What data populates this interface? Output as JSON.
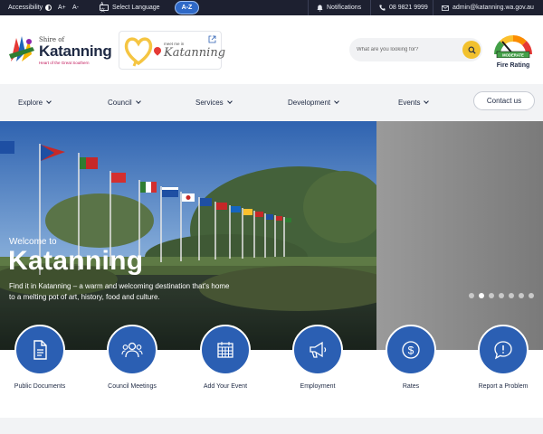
{
  "topbar": {
    "accessibility": "Accessibility",
    "font_up": "A+",
    "font_down": "A-",
    "language": "Select Language",
    "az": "A-Z",
    "notifications": "Notifications",
    "phone": "08 9821 9999",
    "email": "admin@katanning.wa.gov.au"
  },
  "logo": {
    "shire": "Shire of",
    "name": "Katanning",
    "tagline": "Heart of the Great Southern"
  },
  "meet": {
    "small": "meet me in",
    "name": "Katanning"
  },
  "search": {
    "placeholder": "What are you looking for?"
  },
  "fire": {
    "level": "MODERATE",
    "label": "Fire Rating"
  },
  "nav": {
    "items": [
      "Explore",
      "Council",
      "Services",
      "Development",
      "Events"
    ],
    "contact": "Contact us"
  },
  "hero": {
    "welcome": "Welcome to",
    "title": "Katanning",
    "subtitle": "Find it in Katanning – a warm and welcoming destination that's home to a melting pot of art, history, food and culture.",
    "slides_total": 7,
    "active_slide": 2
  },
  "quick_links": [
    {
      "label": "Public Documents",
      "icon": "document-icon"
    },
    {
      "label": "Council Meetings",
      "icon": "people-icon"
    },
    {
      "label": "Add Your Event",
      "icon": "calendar-icon"
    },
    {
      "label": "Employment",
      "icon": "megaphone-icon"
    },
    {
      "label": "Rates",
      "icon": "dollar-icon"
    },
    {
      "label": "Report a Problem",
      "icon": "chat-alert-icon"
    }
  ],
  "colors": {
    "topbar": "#1d2030",
    "accent_blue": "#2b5fb3",
    "search_yellow": "#f2c12e",
    "nav_bg": "#f2f3f5"
  }
}
